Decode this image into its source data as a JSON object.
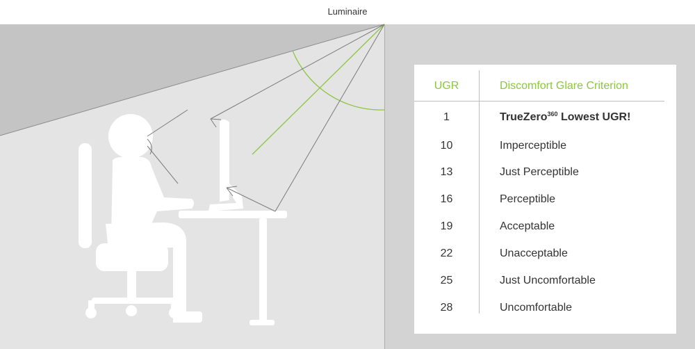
{
  "diagram": {
    "luminaire_label": "Luminaire"
  },
  "colors": {
    "accent_green": "#8dc63f",
    "wall_grey": "#d2d2d2",
    "silhouette_white": "#ffffff",
    "line_grey": "#7a7a7a"
  },
  "table": {
    "header": {
      "ugr": "UGR",
      "criterion": "Discomfort Glare Criterion"
    },
    "highlight": {
      "ugr": "1",
      "brand": "TrueZero",
      "brand_sup": "360",
      "rest": " Lowest UGR!"
    },
    "rows": [
      {
        "ugr": "10",
        "criterion": "Imperceptible"
      },
      {
        "ugr": "13",
        "criterion": "Just Perceptible"
      },
      {
        "ugr": "16",
        "criterion": "Perceptible"
      },
      {
        "ugr": "19",
        "criterion": "Acceptable"
      },
      {
        "ugr": "22",
        "criterion": "Unacceptable"
      },
      {
        "ugr": "25",
        "criterion": "Just Uncomfortable"
      },
      {
        "ugr": "28",
        "criterion": "Uncomfortable"
      }
    ]
  }
}
